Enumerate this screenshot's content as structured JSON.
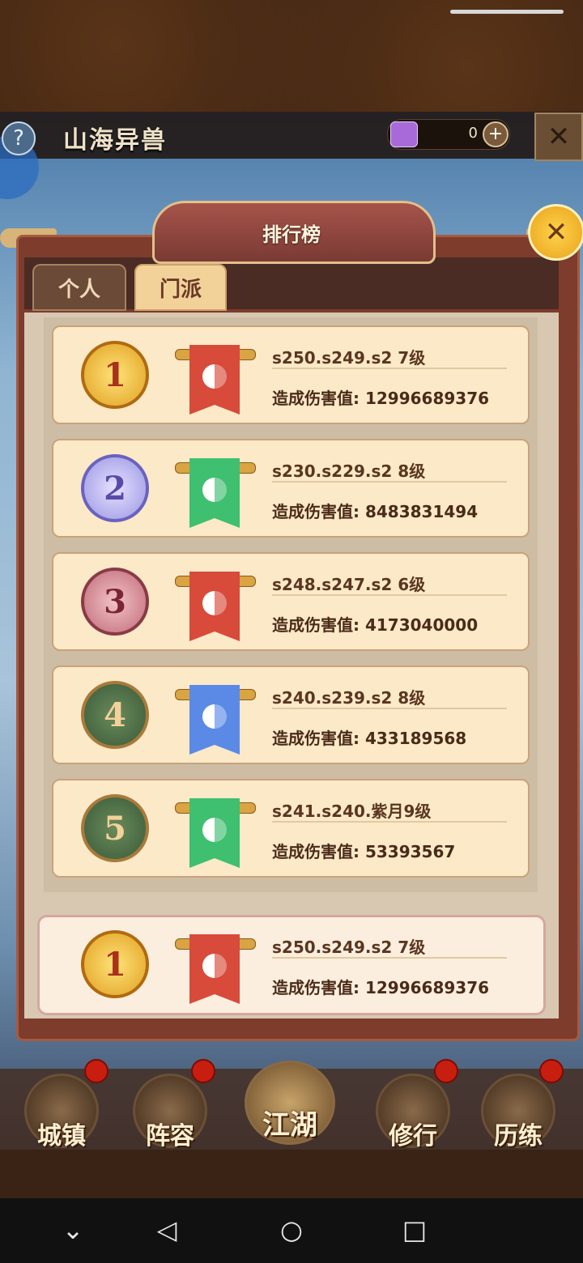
{
  "game": {
    "title": "山海异兽",
    "help_icon": "?",
    "currency_value": "0",
    "plus_icon": "+",
    "close_icon": "✕"
  },
  "panel": {
    "title": "排行榜",
    "tabs": [
      {
        "label": "个人",
        "active": false
      },
      {
        "label": "门派",
        "active": true
      }
    ],
    "close_icon": "✕"
  },
  "ranking": [
    {
      "rank": "1",
      "name": "s250.s249.s2 7级",
      "damage": "造成伤害值: 12996689376",
      "flag_color": "#d84a3a"
    },
    {
      "rank": "2",
      "name": "s230.s229.s2 8级",
      "damage": "造成伤害值: 8483831494",
      "flag_color": "#3fbf70"
    },
    {
      "rank": "3",
      "name": "s248.s247.s2 6级",
      "damage": "造成伤害值: 4173040000",
      "flag_color": "#d84a3a"
    },
    {
      "rank": "4",
      "name": "s240.s239.s2 8级",
      "damage": "造成伤害值: 433189568",
      "flag_color": "#5a8ae6"
    },
    {
      "rank": "5",
      "name": "s241.s240.紫月9级",
      "damage": "造成伤害值: 53393567",
      "flag_color": "#3fbf70"
    }
  ],
  "my_rank": {
    "rank": "1",
    "name": "s250.s249.s2 7级",
    "damage": "造成伤害值: 12996689376",
    "flag_color": "#d84a3a"
  },
  "bottom_nav": [
    {
      "label": "城镇"
    },
    {
      "label": "阵容"
    },
    {
      "label": "江湖"
    },
    {
      "label": "修行"
    },
    {
      "label": "历练"
    }
  ],
  "system_nav": {
    "down": "⌄",
    "back": "◁",
    "home": "○",
    "recent": "□"
  },
  "colors": {
    "gold_badge": "#f2c23c",
    "silver_badge": "#a9a6e8",
    "bronze_badge": "#c87a80",
    "plain_badge": "#b88a4a"
  }
}
